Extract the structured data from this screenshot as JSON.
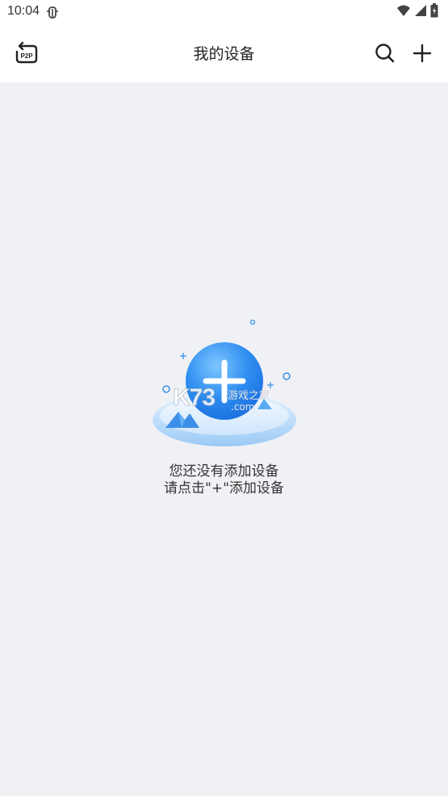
{
  "status_bar": {
    "time": "10:04",
    "icons": [
      "bug-icon",
      "wifi-icon",
      "cellular-signal-icon",
      "battery-icon"
    ]
  },
  "header": {
    "title": "我的设备",
    "left_button_icon": "p2p-switch-icon",
    "left_button_label": "P2P",
    "right_icons": [
      "search-icon",
      "add-icon"
    ]
  },
  "empty_state": {
    "illustration_icon": "add-device-illustration",
    "line1": "您还没有添加设备",
    "line2": "请点击\"+\"添加设备"
  },
  "watermark": {
    "brand": "K73",
    "site_cn": "游戏之家",
    "domain": ".com"
  },
  "colors": {
    "background": "#f0f1f5",
    "header_background": "#ffffff",
    "accent_blue": "#2f8ef0",
    "text_primary": "#333333"
  }
}
